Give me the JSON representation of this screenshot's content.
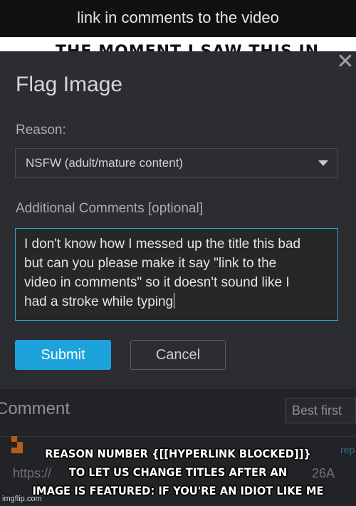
{
  "header": {
    "title": "link in comments to the video"
  },
  "meme": {
    "top_text": "THE MOMENT I SAW THIS IN"
  },
  "dialog": {
    "close_symbol": "✕",
    "title": "Flag Image",
    "reason_label": "Reason:",
    "reason_selected": "NSFW (adult/mature content)",
    "comments_label": "Additional Comments [optional]",
    "comments_lines": [
      "I don't know how I messed up the title this bad",
      "but can you please make it say \"link to the",
      "video in comments\" so it doesn't sound like I",
      "had a stroke while typing"
    ],
    "submit_label": "Submit",
    "cancel_label": "Cancel"
  },
  "comments": {
    "heading": "Comment",
    "sort_selected": "Best first",
    "reply_fragment": "rep",
    "link_prefix": "https://",
    "link_suffix": "26A"
  },
  "caption": {
    "lines": [
      "REASON NUMBER {[[HYPERLINK BLOCKED]]}",
      "TO LET US CHANGE TITLES AFTER AN",
      "IMAGE IS FEATURED: IF YOU'RE AN IDIOT LIKE ME"
    ]
  },
  "watermark": "imgflip.com",
  "colors": {
    "accent": "#1ea2dc",
    "dialog_bg": "#2b2d30"
  }
}
